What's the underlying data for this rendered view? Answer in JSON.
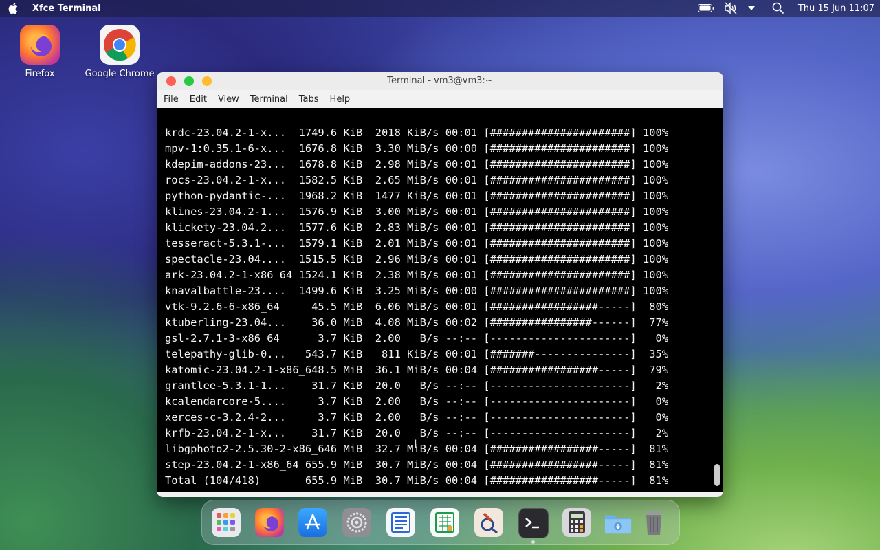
{
  "menubar": {
    "app_title": "Xfce Terminal",
    "clock": "Thu 15 Jun  11:07"
  },
  "desktop": {
    "icons": [
      {
        "label": "Firefox"
      },
      {
        "label": "Google Chrome"
      }
    ]
  },
  "window": {
    "title": "Terminal - vm3@vm3:~",
    "menu": [
      "File",
      "Edit",
      "View",
      "Terminal",
      "Tabs",
      "Help"
    ]
  },
  "terminal": {
    "lines": [
      "krdc-23.04.2-1-x...  1749.6 KiB  2018 KiB/s 00:01 [######################] 100%",
      "mpv-1:0.35.1-6-x...  1676.8 KiB  3.30 MiB/s 00:00 [######################] 100%",
      "kdepim-addons-23...  1678.8 KiB  2.98 MiB/s 00:01 [######################] 100%",
      "rocs-23.04.2-1-x...  1582.5 KiB  2.65 MiB/s 00:01 [######################] 100%",
      "python-pydantic-...  1968.2 KiB  1477 KiB/s 00:01 [######################] 100%",
      "klines-23.04.2-1...  1576.9 KiB  3.00 MiB/s 00:01 [######################] 100%",
      "klickety-23.04.2...  1577.6 KiB  2.83 MiB/s 00:01 [######################] 100%",
      "tesseract-5.3.1-...  1579.1 KiB  2.01 MiB/s 00:01 [######################] 100%",
      "spectacle-23.04....  1515.5 KiB  2.96 MiB/s 00:01 [######################] 100%",
      "ark-23.04.2-1-x86_64 1524.1 KiB  2.38 MiB/s 00:01 [######################] 100%",
      "knavalbattle-23....  1499.6 KiB  3.25 MiB/s 00:00 [######################] 100%",
      "vtk-9.2.6-6-x86_64     45.5 MiB  6.06 MiB/s 00:01 [#################-----]  80%",
      "ktuberling-23.04...    36.0 MiB  4.08 MiB/s 00:02 [################------]  77%",
      "gsl-2.7.1-3-x86_64      3.7 KiB  2.00   B/s --:-- [----------------------]   0%",
      "telepathy-glib-0...   543.7 KiB   811 KiB/s 00:01 [#######---------------]  35%",
      "katomic-23.04.2-1-x86_648.5 MiB  36.1 MiB/s 00:04 [#################-----]  79%",
      "grantlee-5.3.1-1...    31.7 KiB  20.0   B/s --:-- [----------------------]   2%",
      "kcalendarcore-5....     3.7 KiB  2.00   B/s --:-- [----------------------]   0%",
      "xerces-c-3.2.4-2...     3.7 KiB  2.00   B/s --:-- [----------------------]   0%",
      "krfb-23.04.2-1-x...    31.7 KiB  20.0   B/s --:-- [----------------------]   2%",
      "libgphoto2-2.5.30-2-x86_646 MiB  32.7 MiB/s 00:04 [#################-----]  81%",
      "step-23.04.2-1-x86_64 655.9 MiB  30.7 MiB/s 00:04 [#################-----]  81%",
      "Total (104/418)       655.9 MiB  30.7 MiB/s 00:04 [#################-----]  81%"
    ]
  },
  "dock": {
    "items": [
      "launcher-icon",
      "firefox-icon",
      "app-store-icon",
      "settings-icon",
      "writer-icon",
      "calc-icon",
      "image-viewer-icon",
      "terminal-icon",
      "calculator-icon",
      "downloads-folder-icon",
      "trash-icon"
    ]
  }
}
